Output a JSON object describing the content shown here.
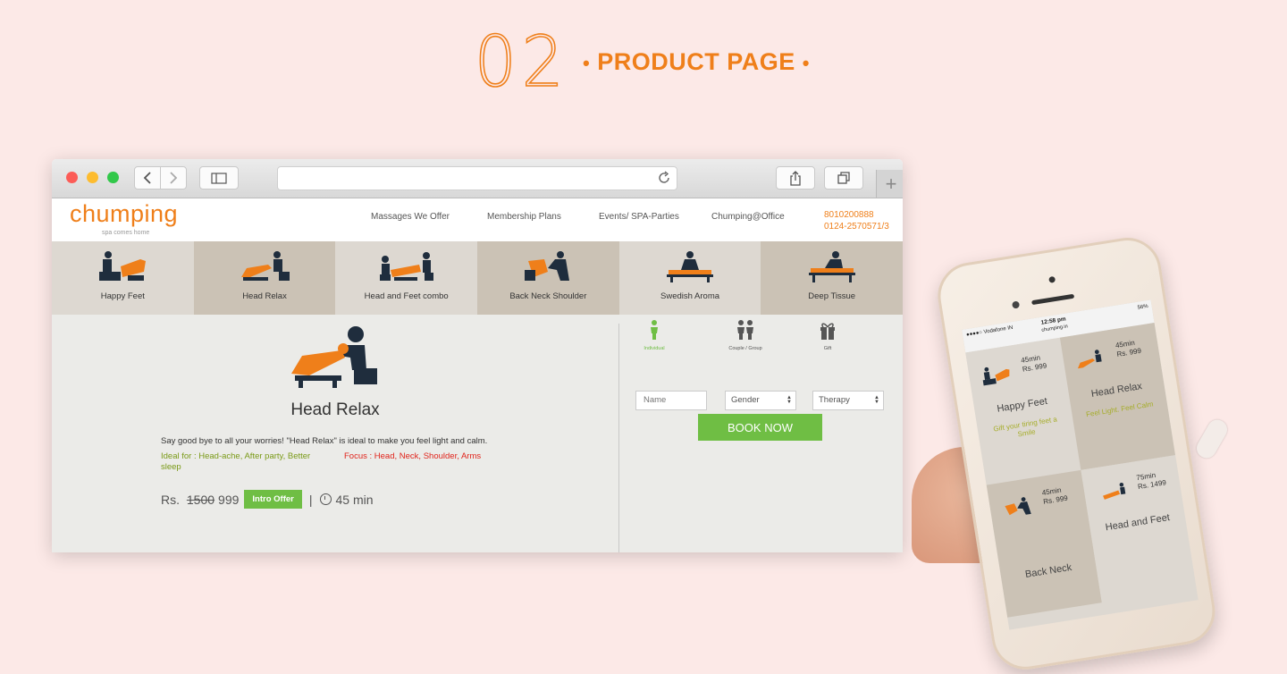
{
  "heading": {
    "number": "02",
    "title": "PRODUCT PAGE",
    "dot": "•"
  },
  "colors": {
    "brand_orange": "#ef7f1a",
    "green": "#6fbe44",
    "navy": "#1f2d3d",
    "focus_red": "#e0231b"
  },
  "site": {
    "logo": "chumping",
    "tagline": "spa comes home",
    "nav": [
      "Massages We Offer",
      "Membership Plans",
      "Events/ SPA-Parties",
      "Chumping@Office"
    ],
    "phone1": "8010200888",
    "phone2": "0124-2570571/3"
  },
  "categories": [
    {
      "label": "Happy Feet",
      "icon": "happy-feet-icon"
    },
    {
      "label": "Head Relax",
      "icon": "head-relax-icon"
    },
    {
      "label": "Head and Feet combo",
      "icon": "head-feet-combo-icon"
    },
    {
      "label": "Back Neck Shoulder",
      "icon": "back-neck-icon"
    },
    {
      "label": "Swedish Aroma",
      "icon": "swedish-aroma-icon"
    },
    {
      "label": "Deep Tissue",
      "icon": "deep-tissue-icon"
    }
  ],
  "product": {
    "title": "Head Relax",
    "description": "Say good bye to all your worries! \"Head Relax\" is ideal to make you feel light and calm.",
    "ideal_for": "Ideal for : Head-ache, After party, Better sleep",
    "focus": "Focus : Head, Neck, Shoulder, Arms",
    "currency": "Rs.",
    "old_price": "1500",
    "price": "999",
    "offer_label": "Intro Offer",
    "separator": "|",
    "duration": "45 min"
  },
  "booking": {
    "types": [
      {
        "label": "Individual",
        "icon": "individual-icon"
      },
      {
        "label": "Couple / Group",
        "icon": "couple-icon"
      },
      {
        "label": "Gift",
        "icon": "gift-icon"
      }
    ],
    "name_placeholder": "Name",
    "gender_label": "Gender",
    "therapy_label": "Therapy",
    "book_label": "BOOK NOW"
  },
  "phone": {
    "carrier": "●●●●○ Vodafone IN",
    "time": "12:58 pm",
    "url": "chumping.in",
    "battery": "56%",
    "tiles": [
      {
        "duration": "45min",
        "price": "Rs. 999",
        "name": "Happy Feet",
        "tagline": "Gift your tiring feet a Smile"
      },
      {
        "duration": "45min",
        "price": "Rs. 999",
        "name": "Head Relax",
        "tagline": "Feel Light. Feel Calm"
      },
      {
        "duration": "45min",
        "price": "Rs. 999",
        "name": "Back Neck",
        "tagline": ""
      },
      {
        "duration": "75min",
        "price": "Rs. 1499",
        "name": "Head and Feet",
        "tagline": ""
      }
    ]
  }
}
